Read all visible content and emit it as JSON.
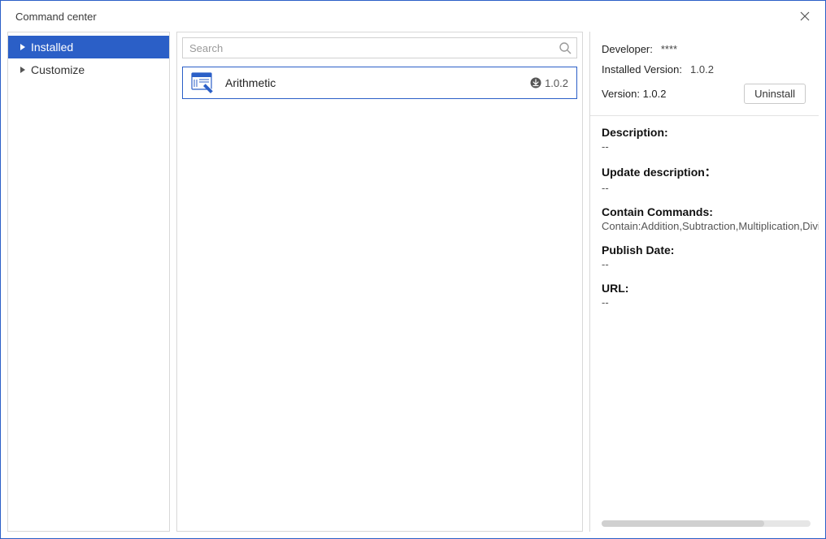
{
  "window": {
    "title": "Command center"
  },
  "sidebar": {
    "items": [
      {
        "label": "Installed",
        "active": true
      },
      {
        "label": "Customize",
        "active": false
      }
    ]
  },
  "search": {
    "placeholder": "Search",
    "value": ""
  },
  "commands": [
    {
      "name": "Arithmetic",
      "version": "1.0.2"
    }
  ],
  "details": {
    "developer_label": "Developer:",
    "developer_value": "****",
    "installed_label": "Installed Version:",
    "installed_value": "1.0.2",
    "version_label": "Version: 1.0.2",
    "uninstall_label": "Uninstall",
    "description_h": "Description:",
    "description_v": "--",
    "update_h": "Update description：",
    "update_v": "--",
    "contain_h": "Contain Commands:",
    "contain_v": "Contain:Addition,Subtraction,Multiplication,Division",
    "publish_h": "Publish Date:",
    "publish_v": "--",
    "url_h": "URL:",
    "url_v": "--"
  }
}
